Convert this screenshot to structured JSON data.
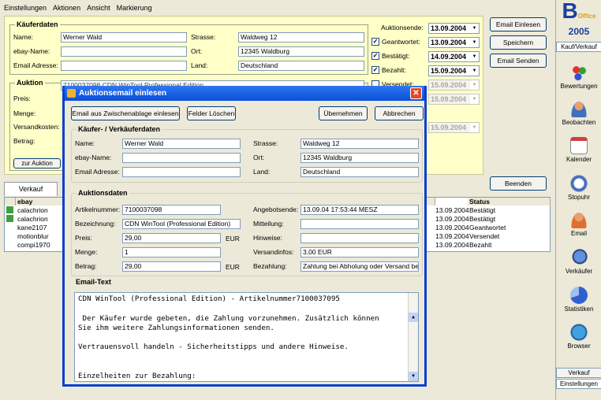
{
  "menu": [
    "Einstellungen",
    "Aktionen",
    "Ansicht",
    "Markierung"
  ],
  "kaeufer_section": {
    "title": "Käuferdaten",
    "name_label": "Name:",
    "name": "Werner Wald",
    "ebay_label": "ebay-Name:",
    "ebay": "",
    "email_label": "Email Adresse:",
    "email": "",
    "strasse_label": "Strasse:",
    "strasse": "Waldweg 12",
    "ort_label": "Ort:",
    "ort": "12345 Waldburg",
    "land_label": "Land:",
    "land": "Deutschland"
  },
  "auktion_section": {
    "title": "Auktion",
    "item": "7100037098 CDN WinTool Professional Edition",
    "preis_label": "Preis:",
    "menge_label": "Menge:",
    "versand_label": "Versandkosten:",
    "betrag_label": "Betrag:",
    "zur_auktion": "zur Auktion"
  },
  "status_section": {
    "auktionsende_label": "Auktionsende:",
    "auktionsende": "13.09.2004",
    "geantwortet_label": "Geantwortet:",
    "geantwortet": "13.09.2004",
    "bestaetigt_label": "Bestätigt:",
    "bestaetigt": "14.09.2004",
    "bezahlt_label": "Bezahlt:",
    "bezahlt": "15.09.2004",
    "versendet_label": "Versendet:",
    "d5": "15.09.2004",
    "d6": "15.09.2004",
    "d7": "15.09.2004"
  },
  "right_buttons": {
    "email_einlesen": "Email Einlesen",
    "speichern": "Speichern",
    "email_senden": "Email Senden",
    "beenden": "Beenden"
  },
  "tabs": {
    "verkauf": "Verkauf"
  },
  "table": {
    "col_ebay": "ebay",
    "col_status": "Status",
    "rows": [
      {
        "ebay": "calachrion",
        "date": "13.09.2004",
        "status": "Bestätigt"
      },
      {
        "ebay": "calachrion",
        "date": "13.09.2004",
        "status": "Bestätigt"
      },
      {
        "ebay": "kane2107",
        "date": "13.09.2004",
        "status": "Geantwortet"
      },
      {
        "ebay": "motionblur",
        "date": "13.09.2004",
        "status": "Versendet"
      },
      {
        "ebay": "compi1970",
        "date": "13.09.2004",
        "status": "Bezahlt"
      }
    ]
  },
  "sidebar": {
    "logo_b": "B",
    "logo_office": "Office",
    "year": "2005",
    "kauf_verkauf": "Kauf/Verkauf",
    "items": [
      "Bewertungen",
      "Beobachten",
      "Kalender",
      "Stopuhr",
      "Email",
      "Verkäufer",
      "Statistiken",
      "Browser"
    ],
    "bottom_verkauf": "Verkauf",
    "bottom_einstellungen": "Einstellungen"
  },
  "dialog": {
    "title": "Auktionsemail einlesen",
    "btn_clipboard": "Email aus Zwischenablage einlesen",
    "btn_clear": "Felder Löschen",
    "btn_ok": "Übernehmen",
    "btn_cancel": "Abbrechen",
    "kv_title": "Käufer- / Verkäuferdaten",
    "name_label": "Name:",
    "name": "Werner Wald",
    "ebay_label": "ebay-Name:",
    "ebay": "",
    "email_label": "Email Adresse:",
    "email": "",
    "strasse_label": "Strasse:",
    "strasse": "Waldweg 12",
    "ort_label": "Ort:",
    "ort": "12345 Waldburg",
    "land_label": "Land:",
    "land": "Deutschland",
    "ad_title": "Auktionsdaten",
    "artikelnummer_label": "Artikelnummer:",
    "artikelnummer": "7100037098",
    "bezeichnung_label": "Bezeichnung:",
    "bezeichnung": "CDN WinTool (Professional Edition)",
    "preis_label": "Preis:",
    "preis": "29,00",
    "preis_unit": "EUR",
    "menge_label": "Menge:",
    "menge": "1",
    "betrag_label": "Betrag:",
    "betrag": "29,00",
    "betrag_unit": "EUR",
    "angebotsende_label": "Angebotsende:",
    "angebotsende": "13.09.04 17:53:44 MESZ",
    "mitteilung_label": "Mitteilung:",
    "mitteilung": "",
    "hinweise_label": "Hinweise:",
    "hinweise": "",
    "versandinfos_label": "Versandinfos:",
    "versandinfos": "3,00 EUR",
    "bezahlung_label": "Bezahlung:",
    "bezahlung": "Zahlung bei Abholung oder Versand bei",
    "emailtext_title": "Email-Text",
    "emailtext": "CDN WinTool (Professional Edition) - Artikelnummer7100037095\n\n Der Käufer wurde gebeten, die Zahlung vorzunehmen. Zusätzlich können\nSie ihm weitere Zahlungsinformationen senden.\n\nVertrauensvoll handeln - Sicherheitstipps und andere Hinweise.\n\n\nEinzelheiten zur Bezahlung:"
  }
}
